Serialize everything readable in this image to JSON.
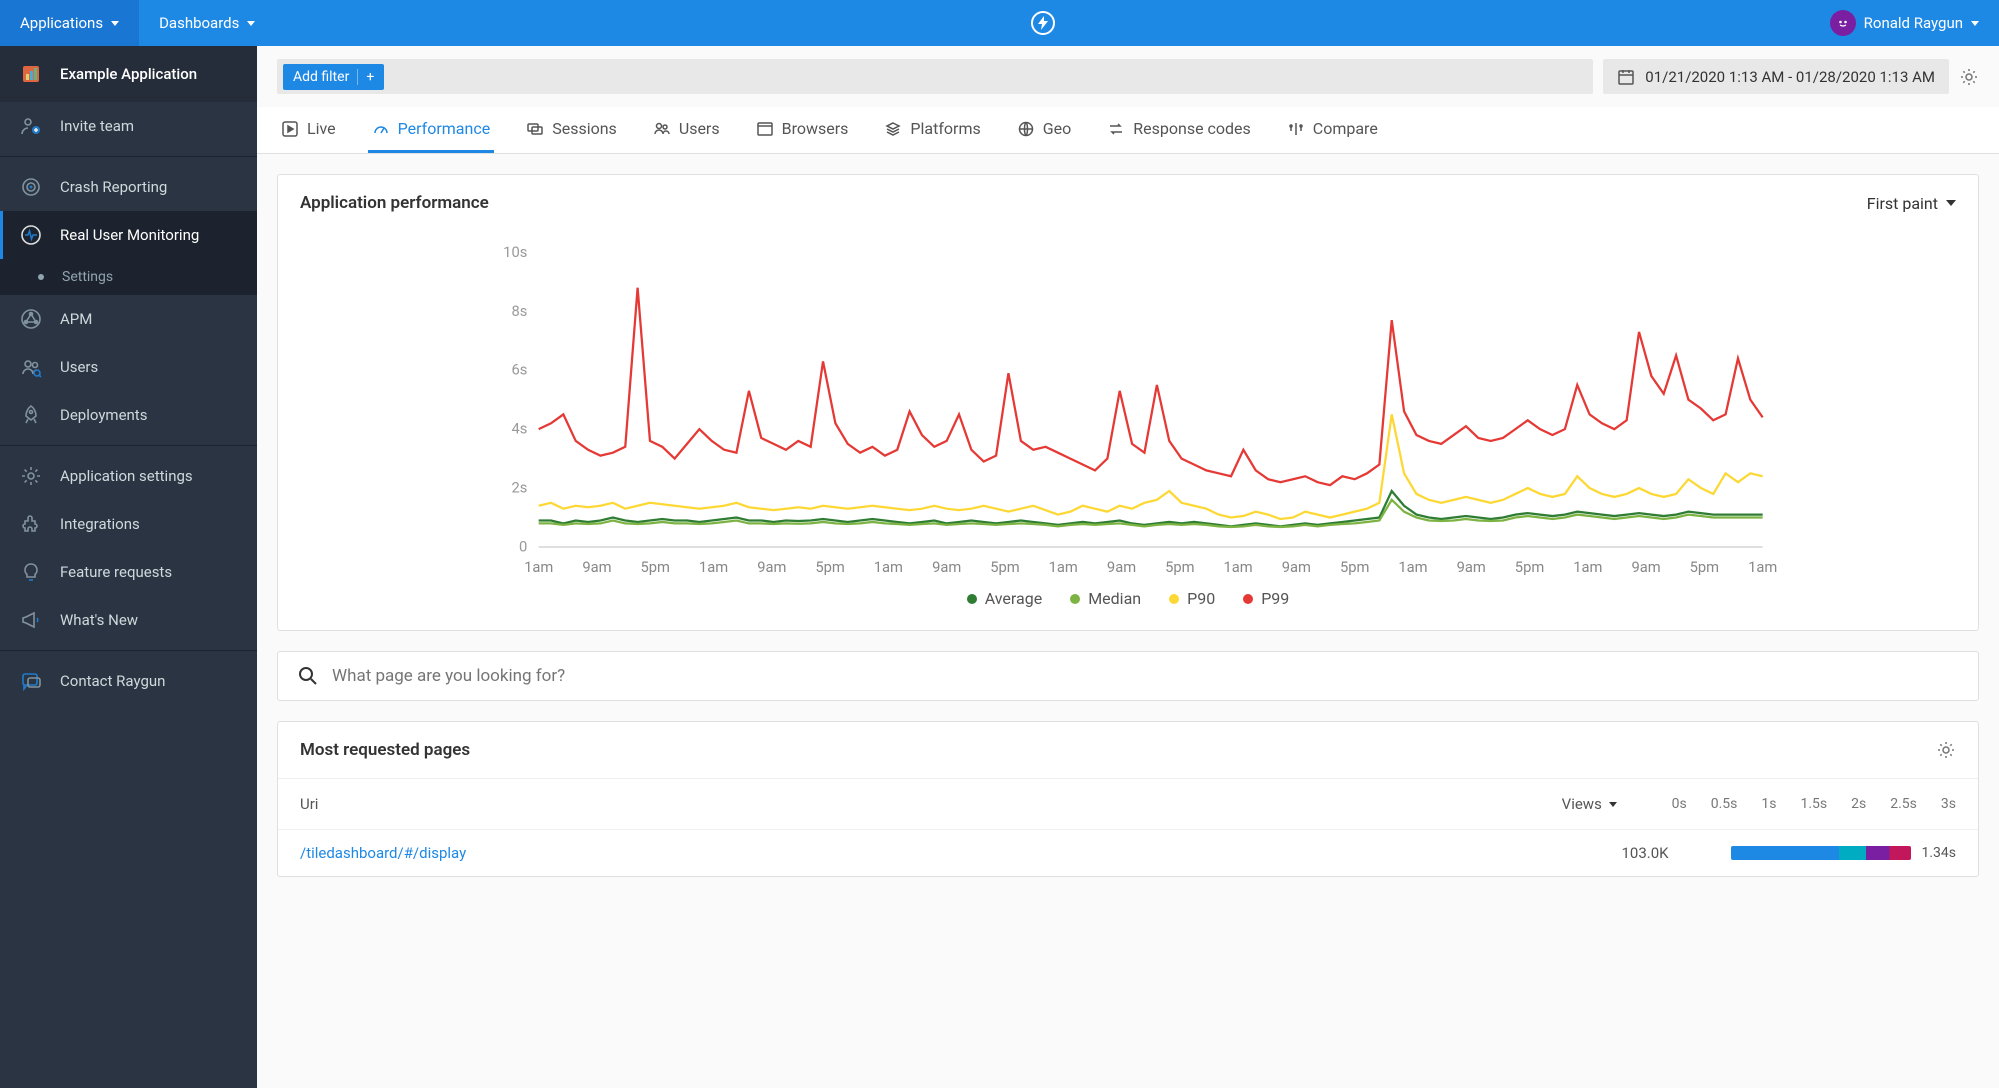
{
  "topbar": {
    "applications": "Applications",
    "dashboards": "Dashboards",
    "user": "Ronald Raygun"
  },
  "sidebar": {
    "app_name": "Example Application",
    "items": {
      "invite": "Invite team",
      "crash": "Crash Reporting",
      "rum": "Real User Monitoring",
      "settings": "Settings",
      "apm": "APM",
      "users": "Users",
      "deployments": "Deployments",
      "app_settings": "Application settings",
      "integrations": "Integrations",
      "feature_requests": "Feature requests",
      "whats_new": "What's New",
      "contact": "Contact Raygun"
    }
  },
  "filter": {
    "add": "Add filter",
    "date_range": "01/21/2020 1:13 AM - 01/28/2020 1:13 AM"
  },
  "tabs": {
    "live": "Live",
    "performance": "Performance",
    "sessions": "Sessions",
    "users": "Users",
    "browsers": "Browsers",
    "platforms": "Platforms",
    "geo": "Geo",
    "response": "Response codes",
    "compare": "Compare"
  },
  "chart": {
    "title": "Application performance",
    "metric": "First paint",
    "legend": {
      "avg": "Average",
      "median": "Median",
      "p90": "P90",
      "p99": "P99"
    }
  },
  "search": {
    "placeholder": "What page are you looking for?"
  },
  "table": {
    "title": "Most requested pages",
    "col_uri": "Uri",
    "col_views": "Views",
    "hist": [
      "0s",
      "0.5s",
      "1s",
      "1.5s",
      "2s",
      "2.5s",
      "3s"
    ],
    "row0_uri": "/tiledashboard/#/display",
    "row0_views": "103.0K",
    "row0_time": "1.34s"
  },
  "chart_data": {
    "type": "line",
    "ylabel_ticks": [
      "0",
      "2s",
      "4s",
      "6s",
      "8s",
      "10s"
    ],
    "ylim": [
      0,
      10
    ],
    "x_ticks": [
      "1am",
      "9am",
      "5pm",
      "1am",
      "9am",
      "5pm",
      "1am",
      "9am",
      "5pm",
      "1am",
      "9am",
      "5pm",
      "1am",
      "9am",
      "5pm",
      "1am",
      "9am",
      "5pm",
      "1am",
      "9am",
      "5pm",
      "1am"
    ],
    "colors": {
      "avg": "#2e7d32",
      "median": "#7cb342",
      "p90": "#fdd835",
      "p99": "#e53935"
    },
    "series": [
      {
        "name": "Average",
        "color": "#2e7d32",
        "values": [
          0.9,
          0.9,
          0.8,
          0.9,
          0.85,
          0.9,
          1.0,
          0.9,
          0.85,
          0.9,
          0.95,
          0.9,
          0.9,
          0.85,
          0.9,
          0.95,
          1.0,
          0.9,
          0.9,
          0.85,
          0.9,
          0.88,
          0.9,
          0.95,
          0.9,
          0.85,
          0.9,
          0.95,
          0.9,
          0.85,
          0.8,
          0.85,
          0.9,
          0.8,
          0.85,
          0.9,
          0.85,
          0.8,
          0.85,
          0.9,
          0.85,
          0.8,
          0.75,
          0.8,
          0.85,
          0.8,
          0.85,
          0.9,
          0.8,
          0.75,
          0.8,
          0.85,
          0.8,
          0.85,
          0.8,
          0.75,
          0.7,
          0.75,
          0.8,
          0.75,
          0.7,
          0.75,
          0.8,
          0.75,
          0.8,
          0.85,
          0.9,
          0.95,
          1.0,
          1.9,
          1.4,
          1.1,
          1.0,
          0.95,
          1.0,
          1.05,
          1.0,
          0.95,
          1.0,
          1.1,
          1.15,
          1.1,
          1.05,
          1.1,
          1.2,
          1.15,
          1.1,
          1.05,
          1.1,
          1.15,
          1.1,
          1.05,
          1.1,
          1.2,
          1.15,
          1.1,
          1.1,
          1.1,
          1.1,
          1.1
        ]
      },
      {
        "name": "Median",
        "color": "#7cb342",
        "values": [
          0.8,
          0.8,
          0.75,
          0.8,
          0.78,
          0.8,
          0.9,
          0.8,
          0.78,
          0.8,
          0.85,
          0.8,
          0.8,
          0.78,
          0.8,
          0.85,
          0.9,
          0.8,
          0.8,
          0.78,
          0.8,
          0.79,
          0.8,
          0.85,
          0.8,
          0.78,
          0.8,
          0.85,
          0.8,
          0.78,
          0.75,
          0.78,
          0.8,
          0.75,
          0.78,
          0.8,
          0.78,
          0.75,
          0.78,
          0.8,
          0.78,
          0.75,
          0.7,
          0.75,
          0.78,
          0.75,
          0.78,
          0.8,
          0.75,
          0.7,
          0.75,
          0.78,
          0.75,
          0.78,
          0.75,
          0.7,
          0.68,
          0.7,
          0.75,
          0.7,
          0.68,
          0.7,
          0.75,
          0.7,
          0.75,
          0.78,
          0.8,
          0.85,
          0.9,
          1.6,
          1.2,
          1.0,
          0.9,
          0.88,
          0.9,
          0.95,
          0.9,
          0.88,
          0.9,
          1.0,
          1.05,
          1.0,
          0.95,
          1.0,
          1.1,
          1.05,
          1.0,
          0.95,
          1.0,
          1.05,
          1.0,
          0.95,
          1.0,
          1.1,
          1.05,
          1.0,
          1.0,
          1.0,
          1.0,
          1.0
        ]
      },
      {
        "name": "P90",
        "color": "#fdd835",
        "values": [
          1.4,
          1.5,
          1.3,
          1.4,
          1.35,
          1.4,
          1.5,
          1.3,
          1.4,
          1.5,
          1.45,
          1.4,
          1.35,
          1.3,
          1.35,
          1.4,
          1.5,
          1.35,
          1.3,
          1.25,
          1.3,
          1.35,
          1.3,
          1.4,
          1.35,
          1.3,
          1.35,
          1.4,
          1.35,
          1.3,
          1.25,
          1.3,
          1.4,
          1.3,
          1.25,
          1.3,
          1.4,
          1.3,
          1.2,
          1.3,
          1.4,
          1.25,
          1.1,
          1.2,
          1.4,
          1.3,
          1.2,
          1.4,
          1.3,
          1.5,
          1.6,
          1.9,
          1.5,
          1.4,
          1.3,
          1.1,
          1.0,
          1.05,
          1.2,
          1.1,
          0.95,
          1.0,
          1.2,
          1.1,
          1.0,
          1.1,
          1.2,
          1.3,
          1.5,
          4.5,
          2.5,
          1.8,
          1.6,
          1.5,
          1.6,
          1.7,
          1.6,
          1.5,
          1.6,
          1.8,
          2.0,
          1.8,
          1.7,
          1.8,
          2.4,
          2.0,
          1.8,
          1.7,
          1.8,
          2.0,
          1.8,
          1.7,
          1.8,
          2.3,
          2.0,
          1.8,
          2.5,
          2.2,
          2.5,
          2.4
        ]
      },
      {
        "name": "P99",
        "color": "#e53935",
        "values": [
          4.0,
          4.2,
          4.5,
          3.6,
          3.3,
          3.1,
          3.2,
          3.4,
          8.8,
          3.6,
          3.4,
          3.0,
          3.5,
          4.0,
          3.6,
          3.3,
          3.2,
          5.3,
          3.7,
          3.5,
          3.3,
          3.6,
          3.4,
          6.3,
          4.2,
          3.5,
          3.2,
          3.4,
          3.1,
          3.3,
          4.6,
          3.8,
          3.4,
          3.6,
          4.5,
          3.3,
          2.9,
          3.1,
          5.9,
          3.6,
          3.3,
          3.4,
          3.2,
          3.0,
          2.8,
          2.6,
          3.0,
          5.3,
          3.5,
          3.2,
          5.5,
          3.6,
          3.0,
          2.8,
          2.6,
          2.5,
          2.4,
          3.3,
          2.6,
          2.3,
          2.2,
          2.3,
          2.4,
          2.2,
          2.1,
          2.4,
          2.3,
          2.5,
          2.8,
          7.7,
          4.6,
          3.8,
          3.6,
          3.5,
          3.8,
          4.1,
          3.7,
          3.6,
          3.7,
          4.0,
          4.3,
          4.0,
          3.8,
          4.0,
          5.5,
          4.5,
          4.2,
          4.0,
          4.3,
          7.3,
          5.8,
          5.2,
          6.5,
          5.0,
          4.7,
          4.3,
          4.5,
          6.4,
          5.0,
          4.4
        ]
      }
    ]
  }
}
